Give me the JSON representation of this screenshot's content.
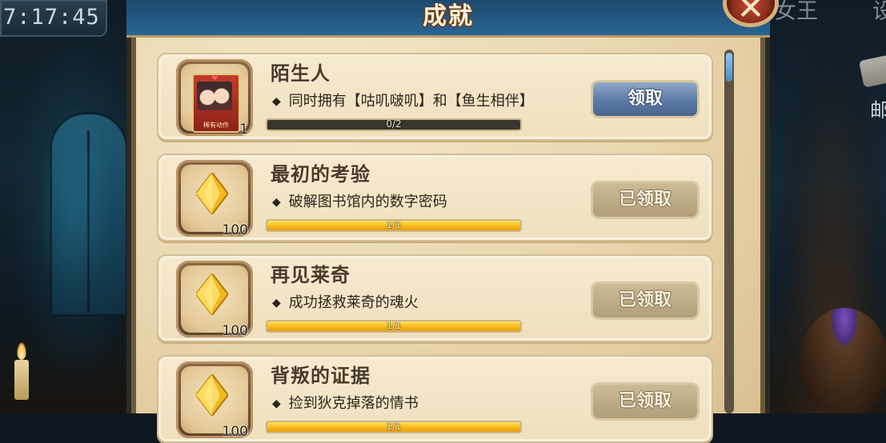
{
  "hud": {
    "clock": "7:17:45",
    "right_menu_partial_1": "女王",
    "right_menu_partial_2": "设",
    "mail_label_partial": "邮"
  },
  "panel": {
    "title": "成就",
    "close_symbol": "✕"
  },
  "achievements": [
    {
      "title": "陌生人",
      "description": "同时拥有【咕叽啵叽】和【鱼生相伴】",
      "reward_type": "card",
      "reward_card_caption": "稀有动作",
      "reward_count": "1",
      "progress_text": "0/2",
      "progress_fraction": 0,
      "button_label": "领取",
      "button_state": "claimable"
    },
    {
      "title": "最初的考验",
      "description": "破解图书馆内的数字密码",
      "reward_type": "crystal",
      "reward_count": "100",
      "progress_text": "1/1",
      "progress_fraction": 1,
      "button_label": "已领取",
      "button_state": "claimed"
    },
    {
      "title": "再见莱奇",
      "description": "成功拯救莱奇的魂火",
      "reward_type": "crystal",
      "reward_count": "100",
      "progress_text": "1/1",
      "progress_fraction": 1,
      "button_label": "已领取",
      "button_state": "claimed"
    },
    {
      "title": "背叛的证据",
      "description": "捡到狄克掉落的情书",
      "reward_type": "crystal",
      "reward_count": "100",
      "progress_text": "1/1",
      "progress_fraction": 1,
      "button_label": "已领取",
      "button_state": "claimed"
    }
  ],
  "colors": {
    "header_blue": "#245a84",
    "parchment": "#ead7b0",
    "progress_gold": "#f7b91c",
    "claim_button": "#5b7aa6"
  }
}
